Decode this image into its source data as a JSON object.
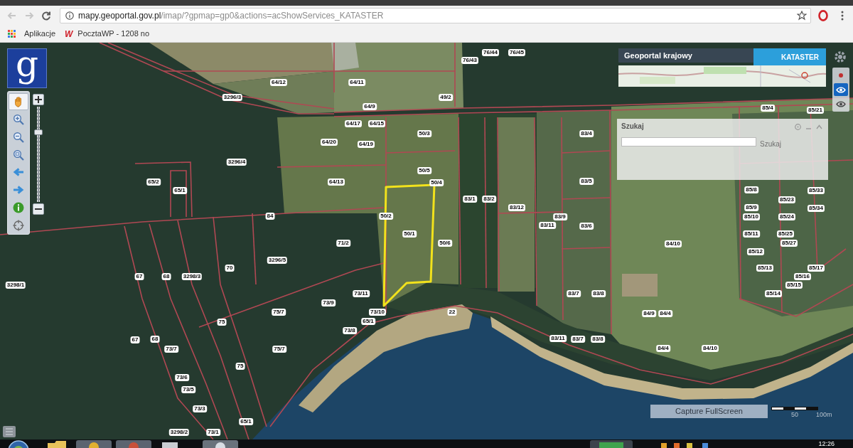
{
  "browser": {
    "nav_buttons": [
      {
        "kind": "back",
        "disabled": true
      },
      {
        "kind": "forward",
        "disabled": true
      },
      {
        "kind": "reload",
        "disabled": false
      }
    ],
    "url": {
      "domain": "mapy.geoportal.gov.pl",
      "path": "/imap/?gpmap=gp0&actions=acShowServices_KATASTER"
    },
    "bookmarks": [
      {
        "kind": "apps",
        "label": "Aplikacje"
      },
      {
        "kind": "site",
        "logo": "W",
        "label": "PocztaWP - 1208 no"
      }
    ]
  },
  "map": {
    "logo": "g",
    "tools": [
      {
        "kind": "pan",
        "selected": true
      },
      {
        "kind": "zoom_in",
        "selected": false
      },
      {
        "kind": "zoom_out",
        "selected": false
      },
      {
        "kind": "zoom_box",
        "selected": false
      },
      {
        "kind": "back",
        "selected": false
      },
      {
        "kind": "forward",
        "selected": false
      },
      {
        "kind": "info",
        "selected": false
      },
      {
        "kind": "locate",
        "selected": false
      }
    ],
    "zoom_slider": {
      "level": 0.75
    },
    "header": {
      "title": "Geoportal krajowy",
      "service": "KATASTER"
    },
    "layer_tools": [
      {
        "kind": "point",
        "selected": false
      },
      {
        "kind": "eye",
        "selected": true
      },
      {
        "kind": "eye",
        "selected": false
      }
    ],
    "search": {
      "title": "Szukaj",
      "button": "Szukaj"
    },
    "parcel_labels": [
      "76/44",
      "76/45",
      "76/43",
      "64/12",
      "64/11",
      "3296/3",
      "49/2",
      "64/9",
      "85/4",
      "85/21",
      "64/17",
      "64/15",
      "50/3",
      "83/4",
      "64/20",
      "64/19",
      "3296/4",
      "50/5",
      "65/2",
      "64/13",
      "50/4",
      "83/5",
      "65/1",
      "85/8",
      "85/33",
      "83/1",
      "83/2",
      "85/23",
      "83/12",
      "85/9",
      "85/34",
      "84",
      "50/2",
      "83/9",
      "85/10",
      "85/24",
      "83/11",
      "83/6",
      "50/1",
      "85/11",
      "85/25",
      "71/2",
      "50/6",
      "84/10",
      "85/27",
      "85/12",
      "3296/5",
      "70",
      "85/13",
      "85/17",
      "67",
      "68",
      "3298/3",
      "85/16",
      "3298/1",
      "85/15",
      "73/11",
      "83/7",
      "83/8",
      "85/14",
      "73/9",
      "75/7",
      "73/10",
      "22",
      "84/9",
      "84/4",
      "75",
      "65/1",
      "73/8",
      "67",
      "68",
      "83/11",
      "83/7",
      "83/8",
      "73/7",
      "75/7",
      "84/4",
      "84/10",
      "75",
      "73/6",
      "73/5",
      "73/3",
      "65/1",
      "3298/2",
      "73/1"
    ],
    "capture_button": "Capture FullScreen",
    "scale_labels": [
      "50",
      "100m"
    ]
  },
  "taskbar": {
    "clock": "12:26"
  }
}
